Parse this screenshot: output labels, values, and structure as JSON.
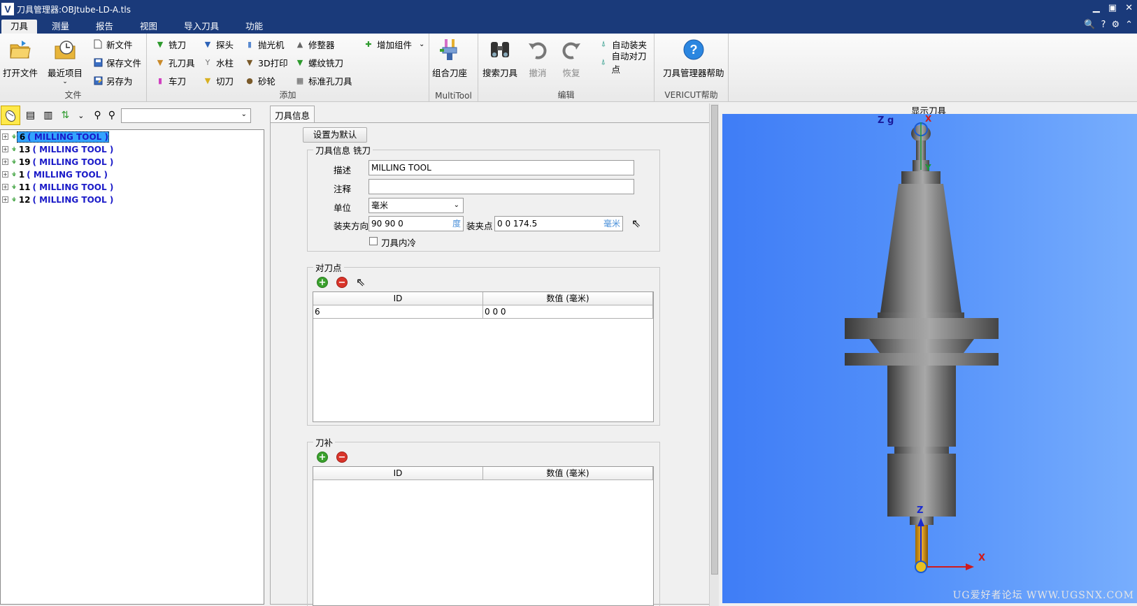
{
  "window": {
    "logo": "V",
    "title": "刀具管理器:OBJtube-LD-A.tls"
  },
  "menu": {
    "tabs": [
      "刀具",
      "测量",
      "报告",
      "视图",
      "导入刀具",
      "功能"
    ]
  },
  "ribbon": {
    "file": {
      "label": "文件",
      "open": "打开文件",
      "recent": "最近项目",
      "new": "新文件",
      "save": "保存文件",
      "saveas": "另存为"
    },
    "add": {
      "label": "添加",
      "mill": "铣刀",
      "probe": "探头",
      "polisher": "抛光机",
      "dresser": "修整器",
      "add_component": "增加组件",
      "hole": "孔刀具",
      "post": "水柱",
      "print3d": "3D打印",
      "thread_mill": "螺纹铣刀",
      "turning": "车刀",
      "cutter": "切刀",
      "wheel": "砂轮",
      "std_hole": "标准孔刀具"
    },
    "multitool": {
      "label": "MultiTool",
      "combo": "组合刀座"
    },
    "edit": {
      "label": "编辑",
      "search": "搜索刀具",
      "undo": "撤消",
      "redo": "恢复",
      "auto_clamp": "自动装夹",
      "auto_gauge": "自动对刀点"
    },
    "help": {
      "label": "VERICUT帮助",
      "btn": "刀具管理器帮助"
    }
  },
  "tree": {
    "items": [
      {
        "id": "6",
        "name": "( MILLING TOOL )",
        "selected": true
      },
      {
        "id": "13",
        "name": "( MILLING TOOL )"
      },
      {
        "id": "19",
        "name": "( MILLING TOOL )"
      },
      {
        "id": "1",
        "name": "( MILLING TOOL )"
      },
      {
        "id": "11",
        "name": "( MILLING TOOL )"
      },
      {
        "id": "12",
        "name": "( MILLING TOOL )"
      }
    ]
  },
  "panel": {
    "tab": "刀具信息",
    "set_default": "设置为默认",
    "info": {
      "legend": "刀具信息 铣刀",
      "desc_label": "描述",
      "desc_value": "MILLING TOOL",
      "note_label": "注释",
      "note_value": "",
      "unit_label": "单位",
      "unit_value": "毫米",
      "orient_label": "装夹方向",
      "orient_value": "90 90 0",
      "orient_unit": "度",
      "point_label": "装夹点",
      "point_value": "0 0 174.5",
      "point_unit": "毫米",
      "coolant_label": "刀具内冷"
    },
    "gauge": {
      "legend": "对刀点",
      "col_id": "ID",
      "col_val": "数值 (毫米)",
      "rows": [
        {
          "id": "6",
          "val": "0 0 0"
        }
      ]
    },
    "offset": {
      "legend": "刀补",
      "col_id": "ID",
      "col_val": "数值 (毫米)"
    }
  },
  "viewer": {
    "title": "显示刀具",
    "axes": {
      "zg": "Z g",
      "x_top": "X",
      "y_top": "Y",
      "z_bottom": "Z",
      "x_bottom": "X"
    },
    "watermark": "UG爱好者论坛 WWW.UGSNX.COM"
  },
  "colors": {
    "titlebar": "#1a3a7a",
    "viewer_bg": "#4d8bf8",
    "selection": "#33a3ff",
    "tree_name": "#1a1ac8"
  }
}
